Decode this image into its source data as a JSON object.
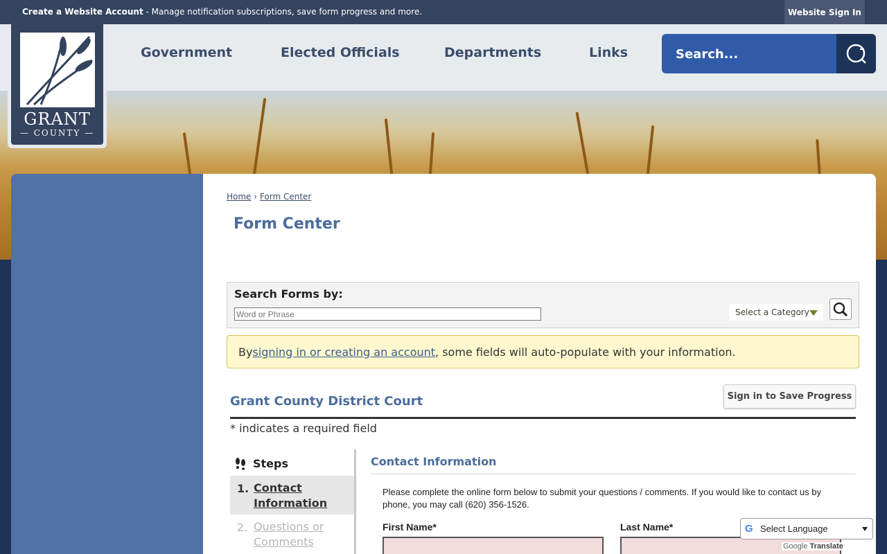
{
  "topbar": {
    "promo_bold": "Create a Website Account",
    "promo_text": " - Manage notification subscriptions, save form progress and more.",
    "signin": "Website Sign In"
  },
  "logo": {
    "line1": "GRANT",
    "line2": "COUNTY"
  },
  "nav": {
    "items": [
      {
        "label": "Government"
      },
      {
        "label": "Elected Officials"
      },
      {
        "label": "Departments"
      },
      {
        "label": "Links"
      }
    ],
    "search_placeholder": "Search..."
  },
  "breadcrumb": {
    "home": "Home",
    "sep": "›",
    "current": "Form Center"
  },
  "page_title": "Form Center",
  "search_forms": {
    "label": "Search Forms by:",
    "placeholder": "Word or Phrase",
    "category": "Select a Category"
  },
  "notice": {
    "prefix": "By ",
    "link": "signing in or creating an account",
    "suffix": ", some fields will auto-populate with your information."
  },
  "form": {
    "title": "Grant County District Court",
    "save_button": "Sign in to Save Progress",
    "required_note": "* indicates a required field"
  },
  "steps": {
    "heading": "Steps",
    "items": [
      {
        "num": "1.",
        "label": "Contact Information"
      },
      {
        "num": "2.",
        "label": "Questions or Comments"
      }
    ]
  },
  "section": {
    "title": "Contact Information",
    "intro": "Please complete the online form below to submit your questions / comments. If you would like to contact us by phone, you may call (620) 356-1526.",
    "first_name": "First Name*",
    "last_name": "Last Name*"
  },
  "translate": {
    "select": "Select Language",
    "powered_prefix": "Google",
    "powered": "Translate"
  },
  "colors": {
    "topbar": "#34435e",
    "accent": "#4b6d9c",
    "search": "#2f5ba9",
    "sidebar": "#5271a5",
    "notice_bg": "#fff8cf",
    "required_field_bg": "#f3dcdc"
  }
}
